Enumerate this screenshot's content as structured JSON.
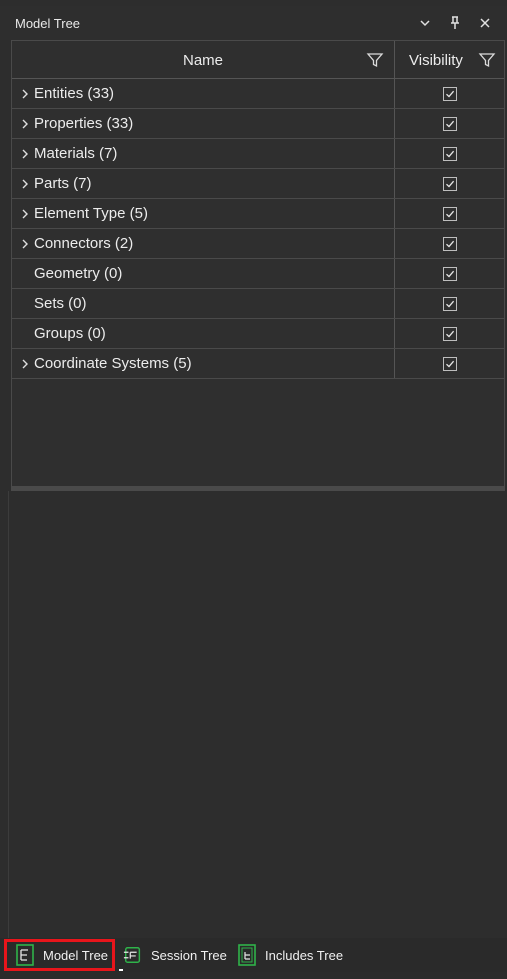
{
  "window": {
    "title": "Model Tree"
  },
  "table": {
    "columns": {
      "name": "Name",
      "visibility": "Visibility"
    },
    "rows": [
      {
        "label": "Entities (33)",
        "expandable": true,
        "visible": true
      },
      {
        "label": "Properties (33)",
        "expandable": true,
        "visible": true
      },
      {
        "label": "Materials (7)",
        "expandable": true,
        "visible": true
      },
      {
        "label": "Parts (7)",
        "expandable": true,
        "visible": true
      },
      {
        "label": "Element Type (5)",
        "expandable": true,
        "visible": true
      },
      {
        "label": "Connectors (2)",
        "expandable": true,
        "visible": true
      },
      {
        "label": "Geometry (0)",
        "expandable": false,
        "visible": true
      },
      {
        "label": "Sets (0)",
        "expandable": false,
        "visible": true
      },
      {
        "label": "Groups (0)",
        "expandable": false,
        "visible": true
      },
      {
        "label": "Coordinate Systems (5)",
        "expandable": true,
        "visible": true
      }
    ]
  },
  "tabs": [
    {
      "label": "Model Tree",
      "active": true,
      "icon": "model-tree-icon"
    },
    {
      "label": "Session Tree",
      "active": false,
      "icon": "session-tree-icon"
    },
    {
      "label": "Includes Tree",
      "active": false,
      "icon": "includes-tree-icon"
    }
  ],
  "colors": {
    "background": "#2d2d2d",
    "text": "#ececec",
    "highlight": "#e8151b",
    "icon_green": "#2fb34a"
  }
}
